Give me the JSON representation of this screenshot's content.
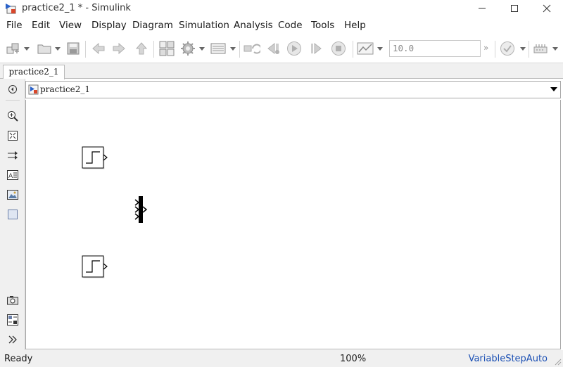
{
  "window": {
    "title": "practice2_1 * - Simulink"
  },
  "menubar": {
    "items": [
      "File",
      "Edit",
      "View",
      "Display",
      "Diagram",
      "Simulation",
      "Analysis",
      "Code",
      "Tools",
      "Help"
    ]
  },
  "toolbar": {
    "stop_time": "10.0",
    "more_glyph": "»"
  },
  "tabs": [
    {
      "label": "practice2_1",
      "active": true
    }
  ],
  "address": {
    "path": "practice2_1"
  },
  "canvas": {
    "blocks": [
      {
        "type": "step",
        "icon": "step-icon"
      },
      {
        "type": "mux",
        "icon": "mux-bar-icon"
      },
      {
        "type": "step",
        "icon": "step-icon"
      }
    ]
  },
  "status": {
    "state": "Ready",
    "zoom": "100%",
    "solver": "VariableStepAuto"
  },
  "colors": {
    "solver_text": "#1a4fb4",
    "play_green": "#3a9a3a",
    "stop_red": "#c0392b"
  }
}
